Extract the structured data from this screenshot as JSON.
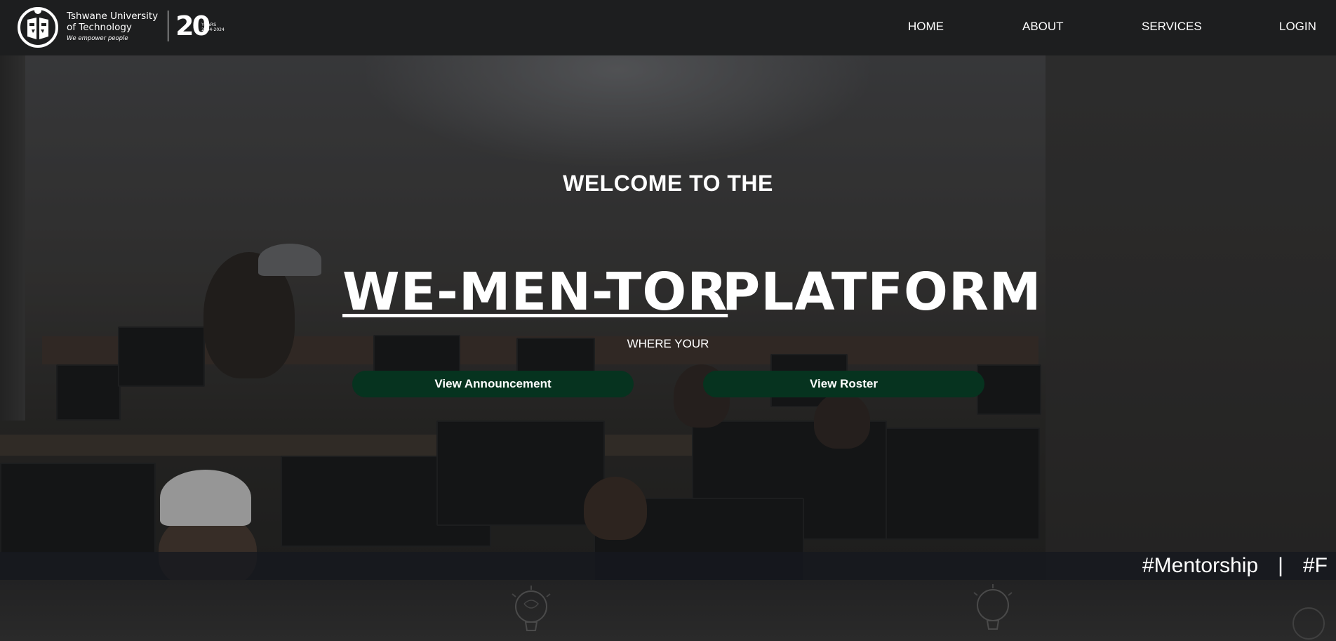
{
  "brand": {
    "university_line1": "Tshwane University",
    "university_line2": "of Technology",
    "tagline": "We empower people",
    "anniversary_number": "20",
    "anniversary_label": "YEARS",
    "anniversary_range": "2004-2024"
  },
  "nav": {
    "items": [
      {
        "label": "HOME"
      },
      {
        "label": "ABOUT"
      },
      {
        "label": "SERVICES"
      },
      {
        "label": "LOGIN"
      }
    ]
  },
  "hero": {
    "welcome": "WELCOME TO THE",
    "title_main": "WE-MEN-TOR",
    "title_second": "PLATFORM",
    "tagline": "WHERE YOUR",
    "buttons": {
      "announcement": "View Announcement",
      "roster": "View Roster"
    }
  },
  "ticker": {
    "items": [
      "#Mentorship",
      "#F"
    ],
    "separator": "|"
  },
  "colors": {
    "header_bg": "#1d1e1f",
    "button_bg": "#06331f",
    "text": "#ffffff"
  },
  "icons": {
    "logo": "university-emblem-icon",
    "decor": "lightbulb-icon"
  }
}
